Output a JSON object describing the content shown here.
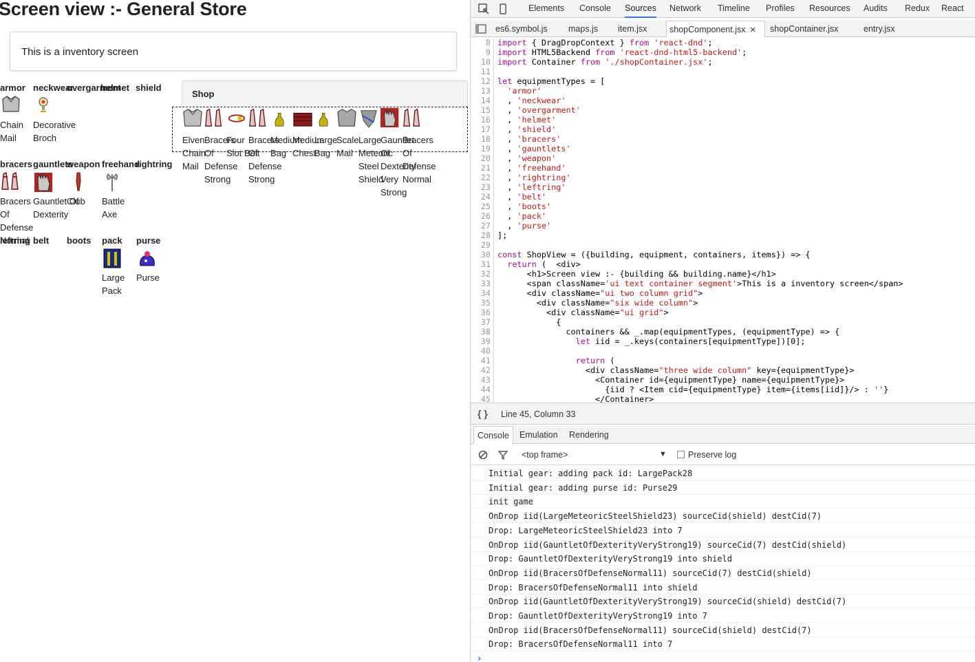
{
  "app": {
    "title": "Screen view :- General Store",
    "segment_text": "This is a inventory screen",
    "slots": [
      {
        "label": "armor",
        "item": "Chain Mail",
        "icon": "chain-mail-icon"
      },
      {
        "label": "neckwear",
        "item": "Decorative Broch",
        "icon": "amulet-icon"
      },
      {
        "label": "overgarment",
        "item": "",
        "icon": ""
      },
      {
        "label": "helmet",
        "item": "",
        "icon": ""
      },
      {
        "label": "shield",
        "item": "",
        "icon": ""
      },
      {
        "label": "bracers",
        "item": "Bracers Of Defense Normal",
        "icon": "bracers-icon"
      },
      {
        "label": "gauntlets",
        "item": "Gauntlet Of Dexterity",
        "icon": "gauntlet-icon"
      },
      {
        "label": "weapon",
        "item": "Club",
        "icon": "club-icon"
      },
      {
        "label": "freehand",
        "item": "Battle Axe",
        "icon": "battle-axe-icon"
      },
      {
        "label": "rightring",
        "item": "",
        "icon": ""
      },
      {
        "label": "leftring",
        "item": "",
        "icon": ""
      },
      {
        "label": "belt",
        "item": "",
        "icon": ""
      },
      {
        "label": "boots",
        "item": "",
        "icon": ""
      },
      {
        "label": "pack",
        "item": "Large Pack",
        "icon": "large-pack-icon"
      },
      {
        "label": "purse",
        "item": "Purse",
        "icon": "purse-icon"
      }
    ],
    "shop_title": "Shop",
    "shop_items": [
      {
        "name": "Elven Chain Mail",
        "icon": "chain-mail-icon"
      },
      {
        "name": "Bracers Of Defense Strong",
        "icon": "bracers-icon"
      },
      {
        "name": "Four Slot Belt",
        "icon": "belt-icon"
      },
      {
        "name": "Bracers Of Defense Strong",
        "icon": "bracers-icon"
      },
      {
        "name": "Medium Bag",
        "icon": "bag-icon"
      },
      {
        "name": "Medium Chest",
        "icon": "chest-icon"
      },
      {
        "name": "Large Bag",
        "icon": "bag-icon"
      },
      {
        "name": "Scale Mail",
        "icon": "scale-mail-icon"
      },
      {
        "name": "Large Meteoric Steel Shield",
        "icon": "shield-icon"
      },
      {
        "name": "Gauntlet Of Dexterity Very Strong",
        "icon": "gauntlet-icon"
      },
      {
        "name": "Bracers Of Defense Normal",
        "icon": "bracers-icon"
      }
    ]
  },
  "devtools": {
    "panel_tabs": [
      "Elements",
      "Console",
      "Sources",
      "Network",
      "Timeline",
      "Profiles",
      "Resources",
      "Audits",
      "Redux",
      "React"
    ],
    "active_panel": "Sources",
    "file_tabs": [
      "es6.symbol.js",
      "maps.js",
      "item.jsx",
      "shopComponent.jsx",
      "shopContainer.jsx",
      "entry.jsx"
    ],
    "active_file": "shopComponent.jsx",
    "code_lines": [
      {
        "n": "8",
        "t": "import { DragDropContext } from 'react-dnd';"
      },
      {
        "n": "9",
        "t": "import HTML5Backend from 'react-dnd-html5-backend';"
      },
      {
        "n": "10",
        "t": "import Container from './shopContainer.jsx';"
      },
      {
        "n": "11",
        "t": ""
      },
      {
        "n": "12",
        "t": "let equipmentTypes = ["
      },
      {
        "n": "13",
        "t": "  'armor'"
      },
      {
        "n": "14",
        "t": "  , 'neckwear'"
      },
      {
        "n": "15",
        "t": "  , 'overgarment'"
      },
      {
        "n": "16",
        "t": "  , 'helmet'"
      },
      {
        "n": "17",
        "t": "  , 'shield'"
      },
      {
        "n": "18",
        "t": "  , 'bracers'"
      },
      {
        "n": "19",
        "t": "  , 'gauntlets'"
      },
      {
        "n": "20",
        "t": "  , 'weapon'"
      },
      {
        "n": "21",
        "t": "  , 'freehand'"
      },
      {
        "n": "22",
        "t": "  , 'rightring'"
      },
      {
        "n": "23",
        "t": "  , 'leftring'"
      },
      {
        "n": "24",
        "t": "  , 'belt'"
      },
      {
        "n": "25",
        "t": "  , 'boots'"
      },
      {
        "n": "26",
        "t": "  , 'pack'"
      },
      {
        "n": "27",
        "t": "  , 'purse'"
      },
      {
        "n": "28",
        "t": "];"
      },
      {
        "n": "29",
        "t": ""
      },
      {
        "n": "30",
        "t": "const ShopView = ({building, equipment, containers, items}) => {"
      },
      {
        "n": "31",
        "t": "  return (  <div>"
      },
      {
        "n": "32",
        "t": "      <h1>Screen view :- {building && building.name}</h1>"
      },
      {
        "n": "33",
        "t": "      <span className='ui text container segment'>This is a inventory screen</span>"
      },
      {
        "n": "34",
        "t": "      <div className=\"ui two column grid\">"
      },
      {
        "n": "35",
        "t": "        <div className=\"six wide column\">"
      },
      {
        "n": "36",
        "t": "          <div className=\"ui grid\">"
      },
      {
        "n": "37",
        "t": "            {"
      },
      {
        "n": "38",
        "t": "              containers && _.map(equipmentTypes, (equipmentType) => {"
      },
      {
        "n": "39",
        "t": "                let iid = _.keys(containers[equipmentType])[0];"
      },
      {
        "n": "40",
        "t": ""
      },
      {
        "n": "41",
        "t": "                return ("
      },
      {
        "n": "42",
        "t": "                  <div className=\"three wide column\" key={equipmentType}>"
      },
      {
        "n": "43",
        "t": "                    <Container id={equipmentType} name={equipmentType}>"
      },
      {
        "n": "44",
        "t": "                      {iid ? <Item cid={equipmentType} item={items[iid]}/> : ''}"
      },
      {
        "n": "45",
        "t": "                    </Container>"
      }
    ],
    "cursor_position": "Line 45, Column 33",
    "drawer_tabs": [
      "Console",
      "Emulation",
      "Rendering"
    ],
    "frame_select": "<top frame>",
    "preserve_log_label": "Preserve log",
    "log": [
      "Initial gear: adding pack id: LargePack28",
      "Initial gear: adding purse id: Purse29",
      "init game",
      "OnDrop iid(LargeMeteoricSteelShield23) sourceCid(shield) destCid(7)",
      "Drop: LargeMeteoricSteelShield23 into 7",
      "OnDrop iid(GauntletOfDexterityVeryStrong19) sourceCid(7) destCid(shield)",
      "Drop: GauntletOfDexterityVeryStrong19 into shield",
      "OnDrop iid(BracersOfDefenseNormal11) sourceCid(7) destCid(shield)",
      "Drop: BracersOfDefenseNormal11 into shield",
      "OnDrop iid(GauntletOfDexterityVeryStrong19) sourceCid(shield) destCid(7)",
      "Drop: GauntletOfDexterityVeryStrong19 into 7",
      "OnDrop iid(BracersOfDefenseNormal11) sourceCid(shield) destCid(7)",
      "Drop: BracersOfDefenseNormal11 into 7"
    ],
    "prompt_glyph": "›"
  }
}
